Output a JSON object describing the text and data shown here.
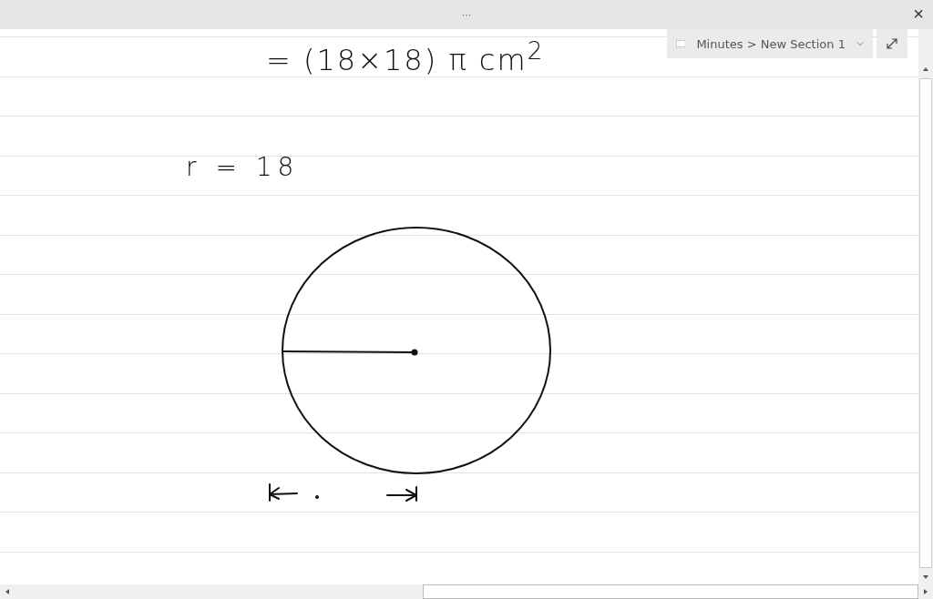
{
  "title_bar": {
    "more": "···",
    "close": "×"
  },
  "breadcrumb": {
    "text": "Minutes > New Section 1"
  },
  "ink": [
    {
      "text": "= (18×18) π cm$^{2}$"
    },
    {
      "text": "r = 18"
    }
  ]
}
